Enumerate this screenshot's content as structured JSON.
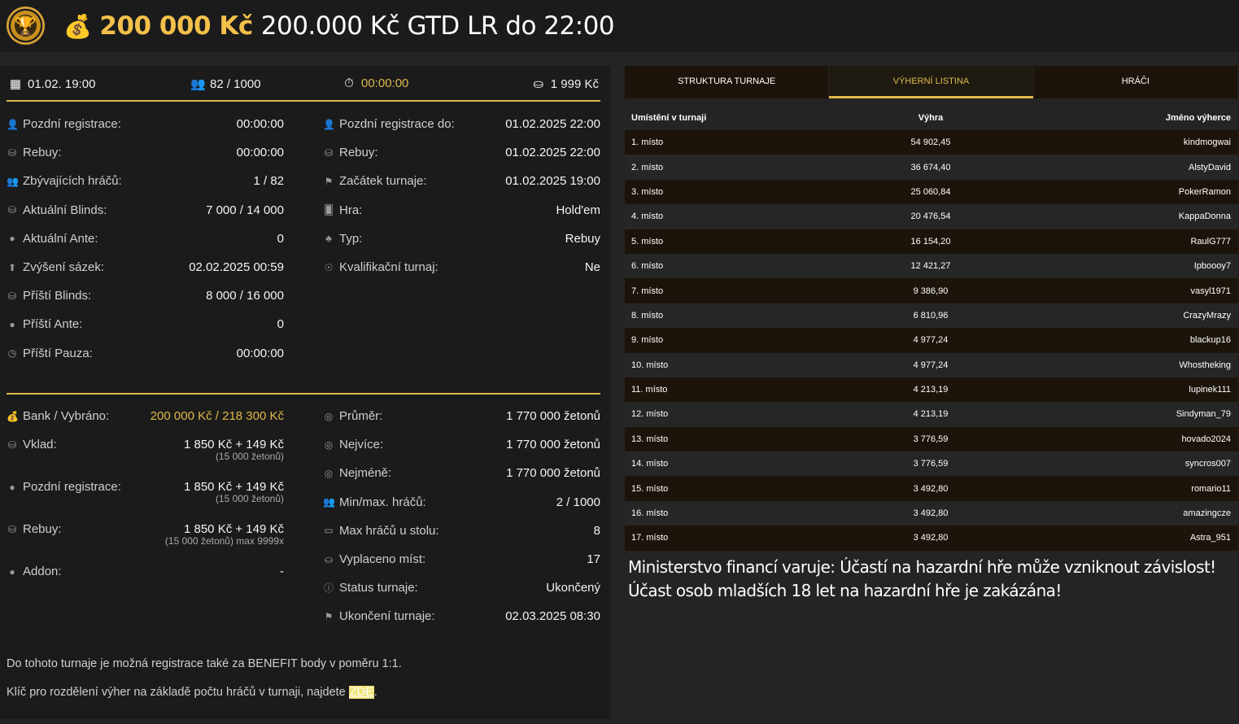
{
  "header": {
    "logo_icon": "trophy-icon",
    "money_icon": "money-bag-icon",
    "guarantee": "200 000 Kč",
    "tournament_name": "200.000 Kč GTD LR do 22:00"
  },
  "summary": {
    "date": "01.02. 19:00",
    "players": "82 / 1000",
    "clock": "00:00:00",
    "prize": "1 999 Kč"
  },
  "info_left": [
    {
      "icon": "user-plus-icon",
      "label": "Pozdní registrace:",
      "value": "00:00:00"
    },
    {
      "icon": "chips-icon",
      "label": "Rebuy:",
      "value": "00:00:00"
    },
    {
      "icon": "users-icon",
      "label": "Zbývajících hráčů:",
      "value": "1 / 82"
    },
    {
      "icon": "chips-icon",
      "label": "Aktuální Blinds:",
      "value": "7 000 / 14 000"
    },
    {
      "icon": "coin-icon",
      "label": "Aktuální Ante:",
      "value": "0"
    },
    {
      "icon": "arrow-up-icon",
      "label": "Zvýšení sázek:",
      "value": "02.02.2025 00:59"
    },
    {
      "icon": "chips-icon",
      "label": "Příští Blinds:",
      "value": "8 000 / 16 000"
    },
    {
      "icon": "coin-icon",
      "label": "Příští Ante:",
      "value": "0"
    },
    {
      "icon": "clock-icon",
      "label": "Příští Pauza:",
      "value": "00:00:00"
    }
  ],
  "info_right": [
    {
      "icon": "user-plus-icon",
      "label": "Pozdní registrace do:",
      "value": "01.02.2025 22:00"
    },
    {
      "icon": "chips-icon",
      "label": "Rebuy:",
      "value": "01.02.2025 22:00"
    },
    {
      "icon": "flag-icon",
      "label": "Začátek turnaje:",
      "value": "01.02.2025 19:00"
    },
    {
      "icon": "cards-icon",
      "label": "Hra:",
      "value": "Hold'em"
    },
    {
      "icon": "suits-icon",
      "label": "Typ:",
      "value": "Rebuy"
    },
    {
      "icon": "medal-icon",
      "label": "Kvalifikační turnaj:",
      "value": "Ne"
    }
  ],
  "bank_left": [
    {
      "icon": "money-bag-icon",
      "label": "Bank / Vybráno:",
      "value": "200 000 Kč / 218 300 Kč",
      "sub": ""
    },
    {
      "icon": "chips-icon",
      "label": "Vklad:",
      "value": "1 850 Kč + 149 Kč",
      "sub": "(15 000 žetonů)"
    },
    {
      "icon": "coin-icon",
      "label": "Pozdní registrace:",
      "value": "1 850 Kč + 149 Kč",
      "sub": "(15 000 žetonů)"
    },
    {
      "icon": "chips-icon",
      "label": "Rebuy:",
      "value": "1 850 Kč + 149 Kč",
      "sub": "(15 000 žetonů) max 9999x"
    },
    {
      "icon": "coin-icon",
      "label": "Addon:",
      "value": "-",
      "sub": ""
    }
  ],
  "bank_right": [
    {
      "icon": "chip-icon",
      "label": "Průměr:",
      "value": "1 770 000 žetonů"
    },
    {
      "icon": "chip-icon",
      "label": "Nejvíce:",
      "value": "1 770 000 žetonů"
    },
    {
      "icon": "chip-icon",
      "label": "Nejméně:",
      "value": "1 770 000 žetonů"
    },
    {
      "icon": "users-icon",
      "label": "Min/max. hráčů:",
      "value": "2 / 1000"
    },
    {
      "icon": "table-icon",
      "label": "Max hráčů u stolu:",
      "value": "8"
    },
    {
      "icon": "payout-icon",
      "label": "Vyplaceno míst:",
      "value": "17"
    },
    {
      "icon": "info-icon",
      "label": "Status turnaje:",
      "value": "Ukončený"
    },
    {
      "icon": "flag-icon",
      "label": "Ukončení turnaje:",
      "value": "02.03.2025 08:30"
    }
  ],
  "notes": {
    "benefit": "Do tohoto turnaje je možná registrace také za BENEFIT body v poměru 1:1.",
    "key_prefix": "Klíč pro rozdělení výher na základě počtu hráčů v turnaji, najdete ",
    "key_link": "ZDE",
    "key_suffix": "."
  },
  "tabs": [
    {
      "label": "STRUKTURA TURNAJE",
      "active": false
    },
    {
      "label": "VÝHERNÍ LISTINA",
      "active": true
    },
    {
      "label": "HRÁČI",
      "active": false
    }
  ],
  "payout_table": {
    "headers": [
      "Umístění v turnaji",
      "Výhra",
      "Jméno výherce"
    ],
    "rows": [
      [
        "1. místo",
        "54 902,45",
        "kindmogwai"
      ],
      [
        "2. místo",
        "36 674,40",
        "AlstyDavid"
      ],
      [
        "3. místo",
        "25 060,84",
        "PokerRamon"
      ],
      [
        "4. místo",
        "20 476,54",
        "KappaDonna"
      ],
      [
        "5. místo",
        "16 154,20",
        "RaulG777"
      ],
      [
        "6. místo",
        "12 421,27",
        "Ipbooоy7"
      ],
      [
        "7. místo",
        "9 386,90",
        "vasyl1971"
      ],
      [
        "8. místo",
        "6 810,96",
        "CrazyMrazy"
      ],
      [
        "9. místo",
        "4 977,24",
        "blackup16"
      ],
      [
        "10. místo",
        "4 977,24",
        "Whostheking"
      ],
      [
        "11. místo",
        "4 213,19",
        "lupinek111"
      ],
      [
        "12. místo",
        "4 213,19",
        "Sindyman_79"
      ],
      [
        "13. místo",
        "3 776,59",
        "hovado2024"
      ],
      [
        "14. místo",
        "3 776,59",
        "syncros007"
      ],
      [
        "15. místo",
        "3 492,80",
        "romario11"
      ],
      [
        "16. místo",
        "3 492,80",
        "amazingcze"
      ],
      [
        "17. místo",
        "3 492,80",
        "Astra_951"
      ]
    ]
  },
  "warning": {
    "line1": "Ministerstvo financí varuje: Účastí na hazardní hře může vzniknout závislost!",
    "line2": "Účast osob mladších 18 let na hazardní hře je zakázána!"
  },
  "colors": {
    "accent": "#e0b94a",
    "panel": "#1b1b1b",
    "background": "#242424",
    "row_dark": "#1c140a"
  }
}
